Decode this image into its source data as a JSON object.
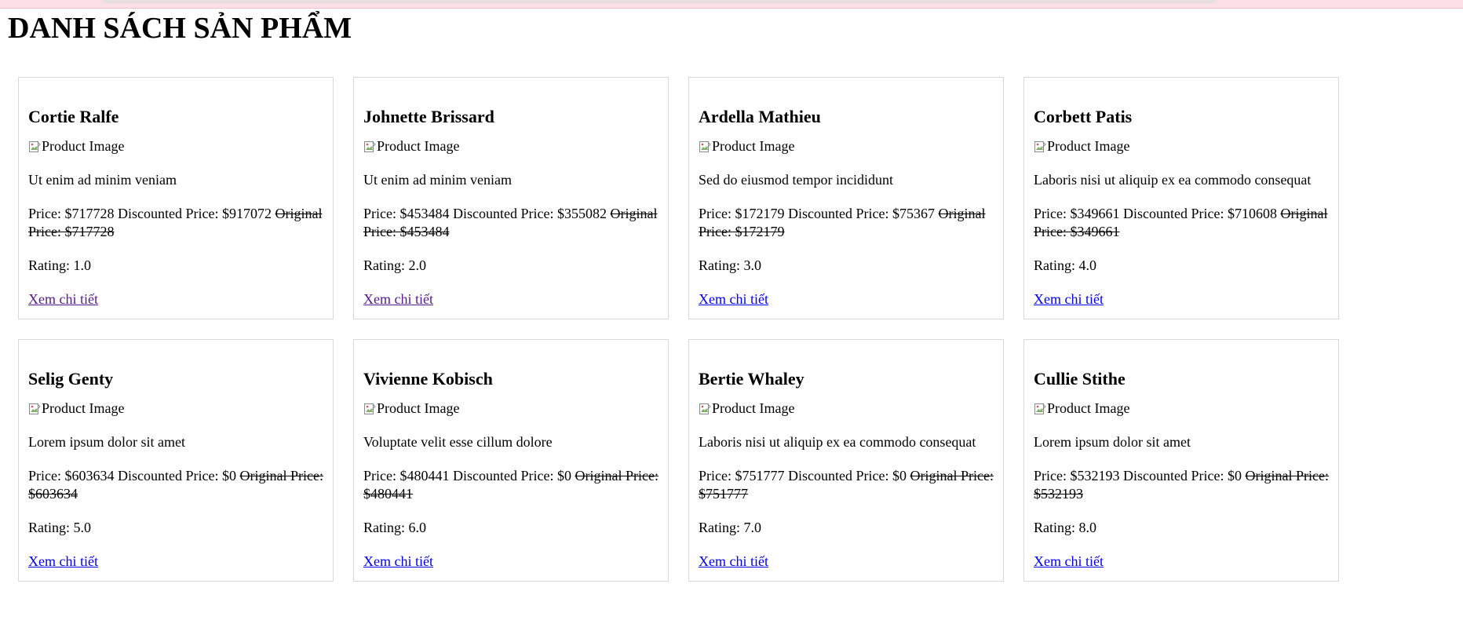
{
  "page": {
    "title": "DANH SÁCH SẢN PHẨM"
  },
  "labels": {
    "image_alt": "Product Image",
    "price": "Price: $",
    "discounted": " Discounted Price: $",
    "original": "Original Price: $",
    "rating": "Rating: ",
    "detail_link": "Xem chi tiết"
  },
  "colors": {
    "link": "#0000ee",
    "visited_link": "#551a8b",
    "card_border": "#d9d9d9"
  },
  "products": [
    {
      "name": "Cortie Ralfe",
      "description": "Ut enim ad minim veniam",
      "price": "717728",
      "discounted_price": "917072",
      "original_price": "717728",
      "rating": "1.0",
      "link_visited": true
    },
    {
      "name": "Johnette Brissard",
      "description": "Ut enim ad minim veniam",
      "price": "453484",
      "discounted_price": "355082",
      "original_price": "453484",
      "rating": "2.0",
      "link_visited": true
    },
    {
      "name": "Ardella Mathieu",
      "description": "Sed do eiusmod tempor incididunt",
      "price": "172179",
      "discounted_price": "75367",
      "original_price": "172179",
      "rating": "3.0",
      "link_visited": false
    },
    {
      "name": "Corbett Patis",
      "description": "Laboris nisi ut aliquip ex ea commodo consequat",
      "price": "349661",
      "discounted_price": "710608",
      "original_price": "349661",
      "rating": "4.0",
      "link_visited": false
    },
    {
      "name": "Selig Genty",
      "description": "Lorem ipsum dolor sit amet",
      "price": "603634",
      "discounted_price": "0",
      "original_price": "603634",
      "rating": "5.0",
      "link_visited": false
    },
    {
      "name": "Vivienne Kobisch",
      "description": "Voluptate velit esse cillum dolore",
      "price": "480441",
      "discounted_price": "0",
      "original_price": "480441",
      "rating": "6.0",
      "link_visited": false
    },
    {
      "name": "Bertie Whaley",
      "description": "Laboris nisi ut aliquip ex ea commodo consequat",
      "price": "751777",
      "discounted_price": "0",
      "original_price": "751777",
      "rating": "7.0",
      "link_visited": false
    },
    {
      "name": "Cullie Stithe",
      "description": "Lorem ipsum dolor sit amet",
      "price": "532193",
      "discounted_price": "0",
      "original_price": "532193",
      "rating": "8.0",
      "link_visited": false
    }
  ]
}
